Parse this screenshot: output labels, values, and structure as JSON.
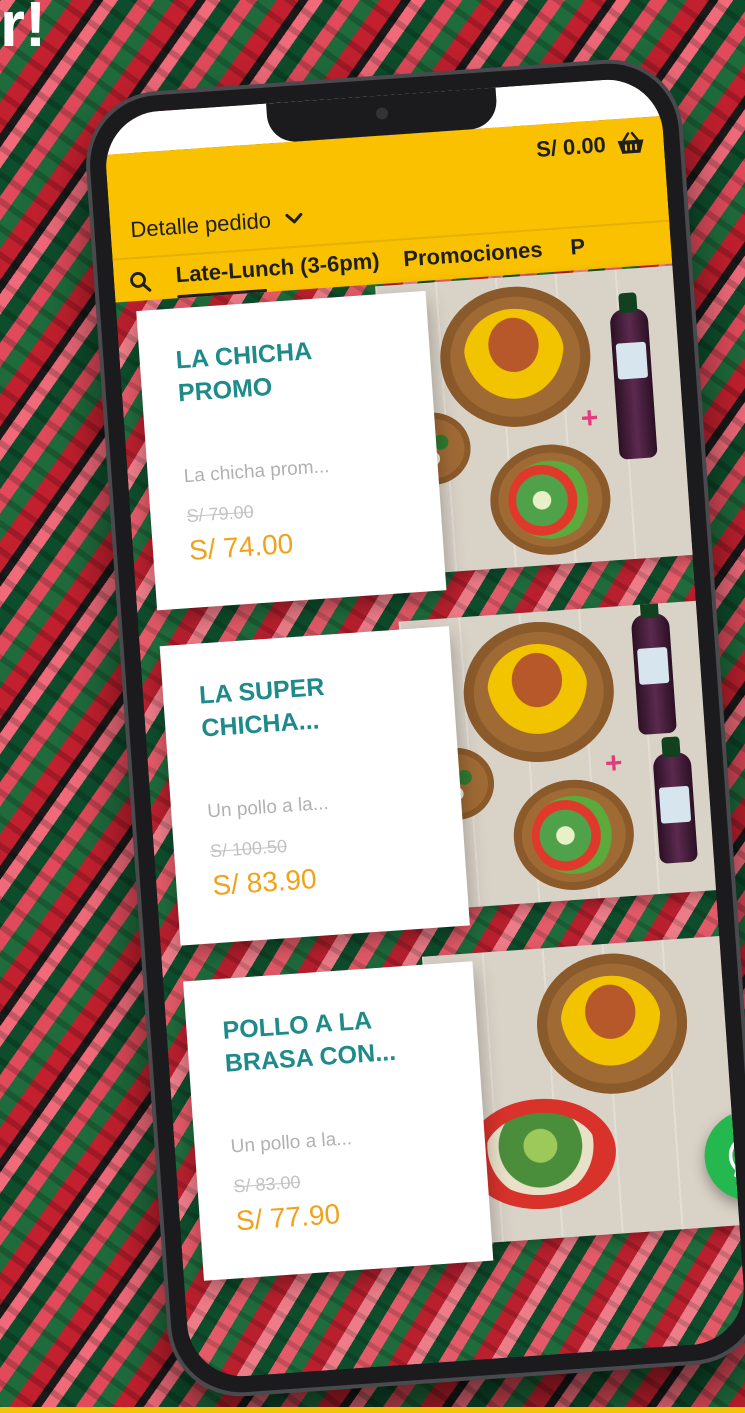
{
  "promo_banner": {
    "corner_text": "r!"
  },
  "header": {
    "cart_total": "S/ 0.00",
    "detail_label": "Detalle pedido",
    "tabs": [
      {
        "label": "Late-Lunch (3-6pm)",
        "active": true
      },
      {
        "label": "Promociones",
        "active": false
      },
      {
        "label": "P",
        "active": false
      }
    ]
  },
  "products": [
    {
      "name": "LA CHICHA PROMO",
      "description": "La chicha prom...",
      "old_price": "S/ 79.00",
      "price": "S/ 74.00"
    },
    {
      "name": "LA SUPER CHICHA...",
      "description": "Un pollo a la...",
      "old_price": "S/ 100.50",
      "price": "S/ 83.90"
    },
    {
      "name": "POLLO A LA BRASA CON...",
      "description": "Un pollo a la...",
      "old_price": "S/ 83.00",
      "price": "S/ 77.90"
    }
  ],
  "colors": {
    "header_bg": "#f9c100",
    "product_name": "#1f8a8a",
    "price_new": "#f2a21a",
    "whatsapp": "#25b84f"
  },
  "icons": [
    "basket-icon",
    "chevron-down-icon",
    "search-icon",
    "plus-icon",
    "whatsapp-icon"
  ]
}
